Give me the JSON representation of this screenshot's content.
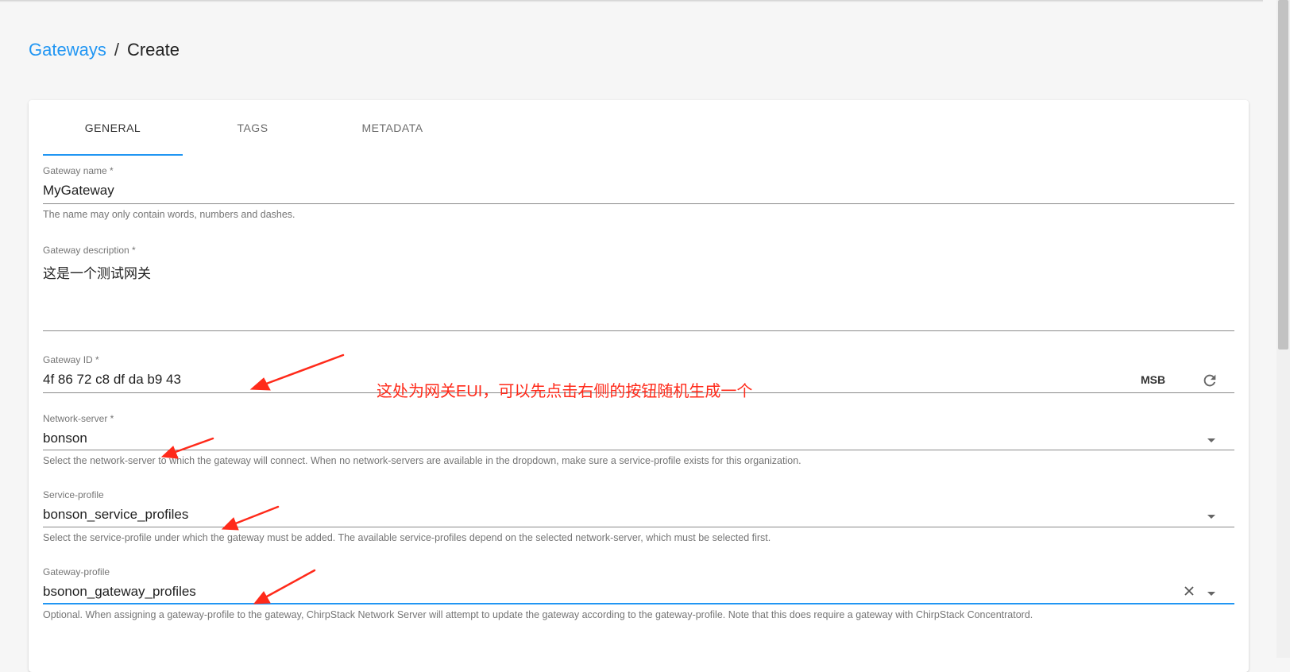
{
  "breadcrumb": {
    "parent": "Gateways",
    "separator": "/",
    "current": "Create"
  },
  "tabs": [
    {
      "label": "GENERAL",
      "active": true
    },
    {
      "label": "TAGS",
      "active": false
    },
    {
      "label": "METADATA",
      "active": false
    }
  ],
  "form": {
    "name": {
      "label": "Gateway name *",
      "value": "MyGateway",
      "helper": "The name may only contain words, numbers and dashes."
    },
    "description": {
      "label": "Gateway description *",
      "value": "这是一个测试网关"
    },
    "gateway_id": {
      "label": "Gateway ID *",
      "value": "4f 86 72 c8 df da b9 43",
      "byte_order": "MSB",
      "refresh_icon": "refresh-icon"
    },
    "network_server": {
      "label": "Network-server *",
      "value": "bonson",
      "helper": "Select the network-server to which the gateway will connect. When no network-servers are available in the dropdown, make sure a service-profile exists for this organization."
    },
    "service_profile": {
      "label": "Service-profile",
      "value": "bonson_service_profiles",
      "helper": "Select the service-profile under which the gateway must be added. The available service-profiles depend on the selected network-server, which must be selected first."
    },
    "gateway_profile": {
      "label": "Gateway-profile",
      "value": "bsonon_gateway_profiles",
      "helper": "Optional. When assigning a gateway-profile to the gateway, ChirpStack Network Server will attempt to update the gateway according to the gateway-profile. Note that this does require a gateway with ChirpStack Concentratord."
    }
  },
  "annotation": {
    "text": "这处为网关EUI，可以先点击右侧的按钮随机生成一个",
    "color": "#ff2a1a"
  },
  "colors": {
    "accent": "#2196f3",
    "background": "#f6f6f6"
  }
}
